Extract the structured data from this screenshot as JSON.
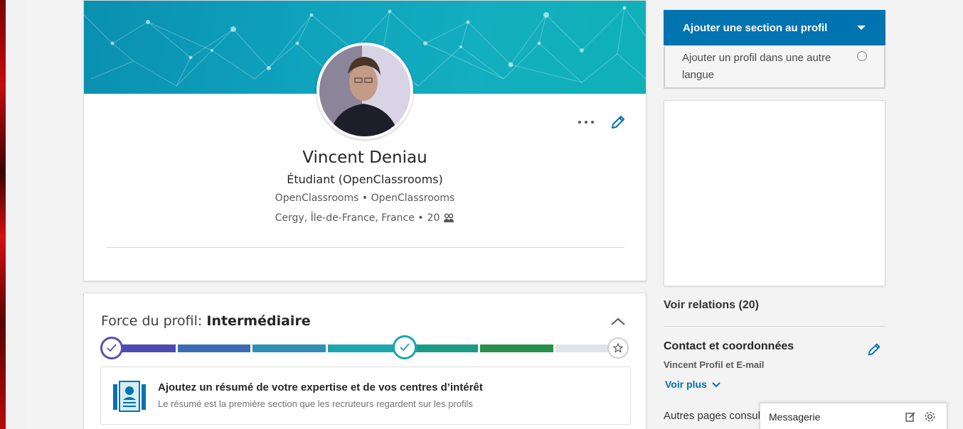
{
  "profile": {
    "name": "Vincent Deniau",
    "headline": "Étudiant (OpenClassrooms)",
    "company_line": "OpenClassrooms • OpenClassrooms",
    "location": "Cergy, Île-de-France, France •",
    "connections_count": "20"
  },
  "strength": {
    "label": "Force du profil:",
    "level": "Intermédiaire",
    "level_fraction": 0.57,
    "tip_title": "Ajoutez un résumé de votre expertise et de vos centres d’intérêt",
    "tip_subtitle": "Le résumé est la première section que les recruteurs regardent sur les profils"
  },
  "sidebar": {
    "add_section_label": "Ajouter une section au profil",
    "add_language_profile": "Ajouter un profil dans une autre langue",
    "relations_label": "Voir relations (20)",
    "contact_title": "Contact et coordonnées",
    "contact_subtitle": "Vincent Profil et E-mail",
    "see_more": "Voir plus",
    "other_pages": "Autres pages consultées"
  },
  "messaging": {
    "label": "Messagerie"
  },
  "colors": {
    "primary": "#0073b1",
    "banner": "#0fa3bc"
  }
}
